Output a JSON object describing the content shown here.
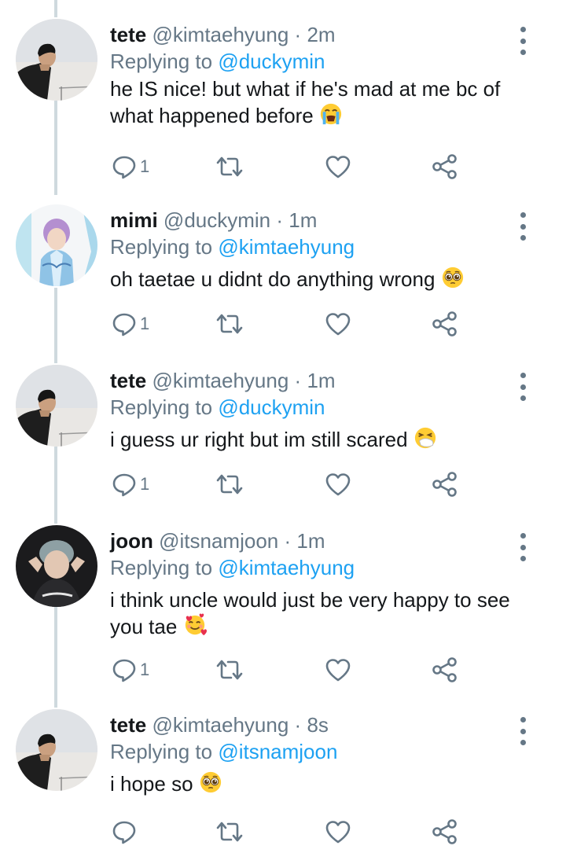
{
  "tweets": [
    {
      "name": "tete",
      "handle": "@kimtaehyung",
      "time": "2m",
      "replying_label": "Replying to",
      "replying_to": "@duckymin",
      "text": "he IS nice! but what if he's mad at me bc of what happened before",
      "emoji": "loudly-crying-face",
      "reply_count": "1",
      "avatar": "tete-avatar"
    },
    {
      "name": "mimi",
      "handle": "@duckymin",
      "time": "1m",
      "replying_label": "Replying to",
      "replying_to": "@kimtaehyung",
      "text": "oh taetae u didnt do anything wrong",
      "emoji": "pleading-face",
      "reply_count": "1",
      "avatar": "mimi-avatar"
    },
    {
      "name": "tete",
      "handle": "@kimtaehyung",
      "time": "1m",
      "replying_label": "Replying to",
      "replying_to": "@duckymin",
      "text": "i guess ur right but im still scared",
      "emoji": "sneezing-face",
      "reply_count": "1",
      "avatar": "tete-avatar"
    },
    {
      "name": "joon",
      "handle": "@itsnamjoon",
      "time": "1m",
      "replying_label": "Replying to",
      "replying_to": "@kimtaehyung",
      "text": "i think uncle would just be very happy to see you tae",
      "emoji": "smiling-face-with-hearts",
      "reply_count": "1",
      "avatar": "joon-avatar"
    },
    {
      "name": "tete",
      "handle": "@kimtaehyung",
      "time": "8s",
      "replying_label": "Replying to",
      "replying_to": "@itsnamjoon",
      "text": "i hope so",
      "emoji": "pleading-face",
      "reply_count": "",
      "avatar": "tete-avatar"
    }
  ],
  "icons": [
    "reply-icon",
    "retweet-icon",
    "like-icon",
    "share-icon",
    "more-options-icon"
  ],
  "colors": {
    "mention": "#1da1f2",
    "secondary_text": "#657786",
    "thread_line": "#cfd9de"
  }
}
